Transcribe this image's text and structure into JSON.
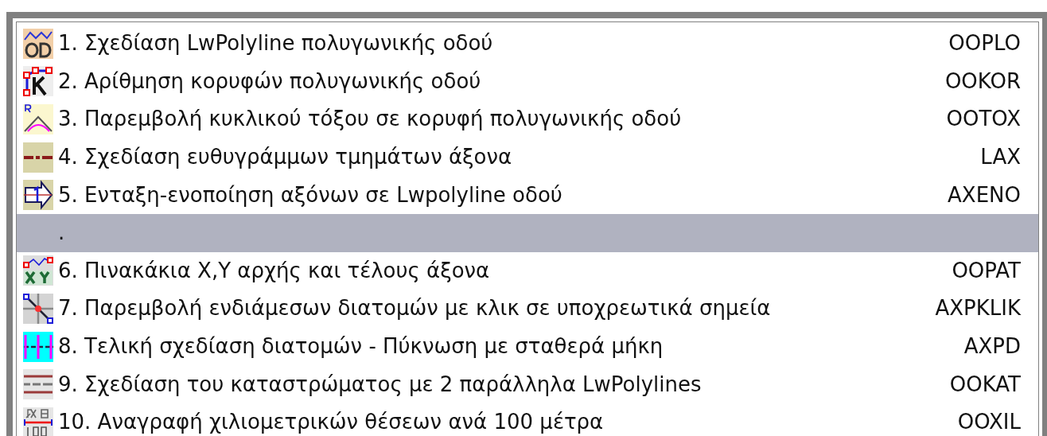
{
  "menu": {
    "items": [
      {
        "kind": "command",
        "label": "1. Σχεδίαση LwPolyline πολυγωνικής οδού",
        "shortcut": "OOPLO",
        "selected": false
      },
      {
        "kind": "command",
        "label": "2. Αρίθμηση κορυφών πολυγωνικής οδού",
        "shortcut": "OOKOR",
        "selected": false
      },
      {
        "kind": "command",
        "label": "3. Παρεμβολή κυκλικού τόξου σε κορυφή πολυγωνικής οδού",
        "shortcut": "OOTOX",
        "selected": false
      },
      {
        "kind": "command",
        "label": "4. Σχεδίαση ευθυγράμμων τμημάτων άξονα",
        "shortcut": "LAX",
        "selected": false
      },
      {
        "kind": "command",
        "label": "5. Ενταξη-ενοποίηση αξόνων σε Lwpolyline οδού",
        "shortcut": "AXENO",
        "selected": false
      },
      {
        "kind": "plain",
        "label": ".",
        "selected": true
      },
      {
        "kind": "command",
        "label": "6. Πινακάκια Χ,Υ αρχής και τέλους άξονα",
        "shortcut": "OOPAT",
        "selected": false
      },
      {
        "kind": "command",
        "label": "7. Παρεμβολή ενδιάμεσων διατομών με κλικ σε υποχρεωτικά σημεία",
        "shortcut": "AXPKLIK",
        "selected": false
      },
      {
        "kind": "command",
        "label": "8. Τελική σχεδίαση διατομών - Πύκνωση με σταθερά μήκη",
        "shortcut": "AXPD",
        "selected": false
      },
      {
        "kind": "command",
        "label": "9. Σχεδίαση του καταστρώματος με 2 παράλληλα LwPolylines",
        "shortcut": "OOKAT",
        "selected": false
      },
      {
        "kind": "command",
        "label": "10. Αναγραφή χιλιομετρικών θέσεων ανά 100 μέτρα",
        "shortcut": "OOXIL",
        "selected": false
      }
    ]
  }
}
